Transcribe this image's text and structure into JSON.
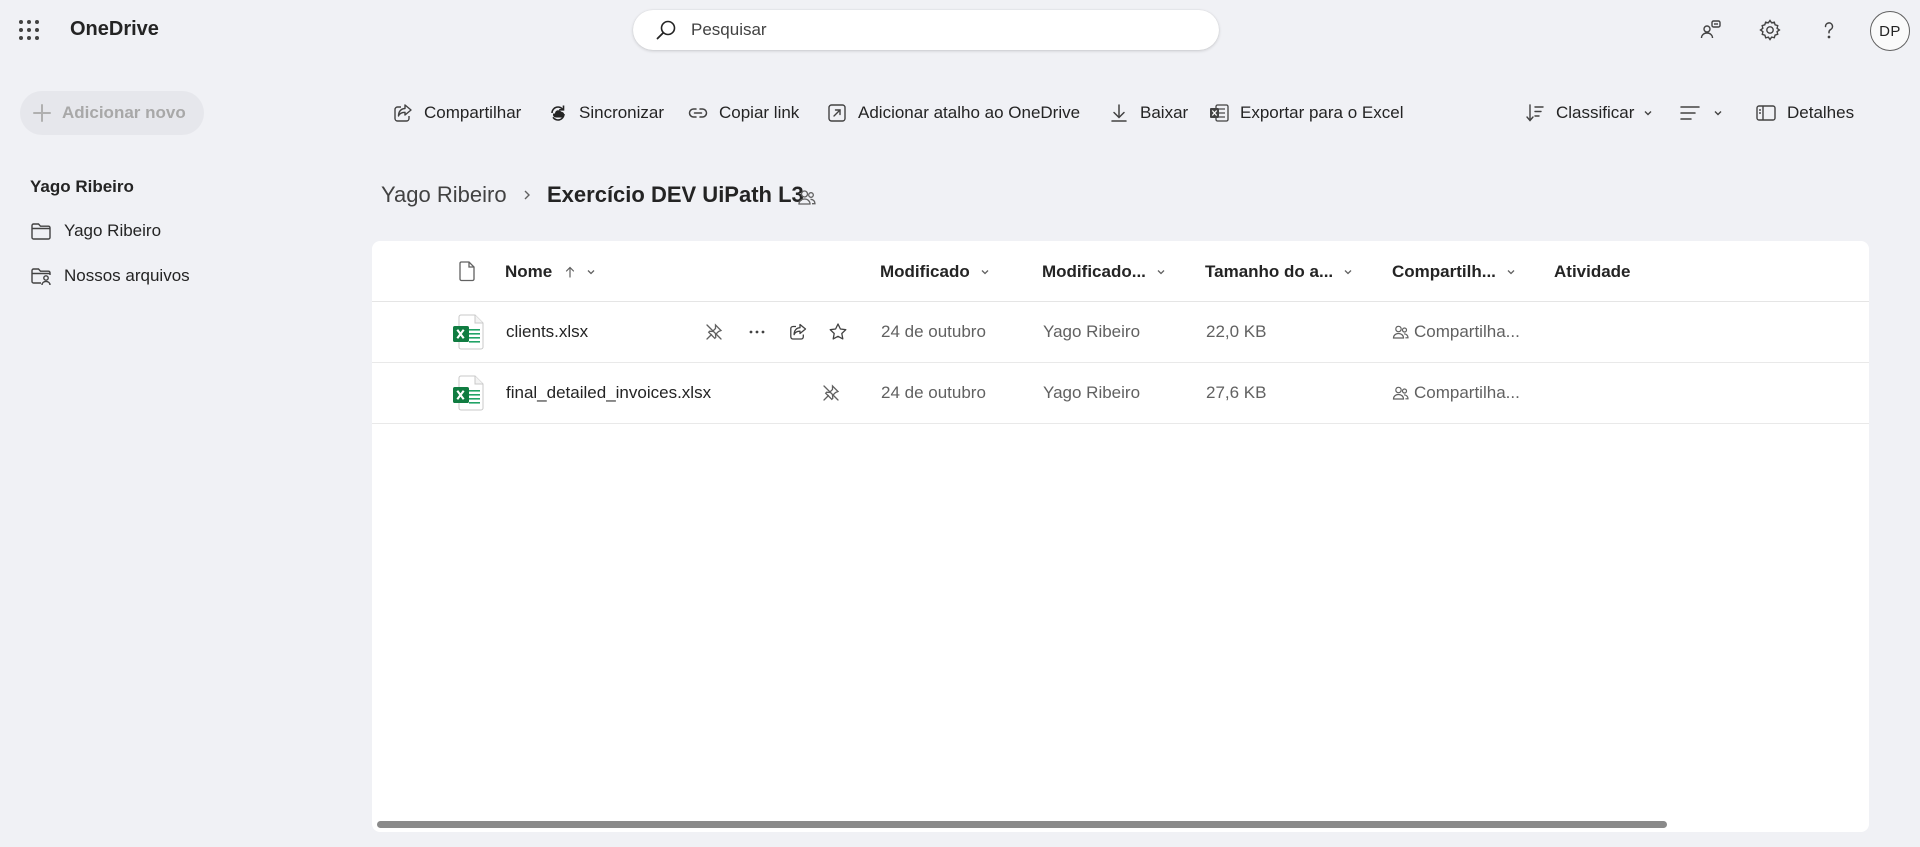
{
  "header": {
    "app_name": "OneDrive",
    "search_placeholder": "Pesquisar",
    "avatar_initials": "DP",
    "icons": [
      "waffle-icon",
      "search-icon",
      "premium-icon",
      "gear-icon",
      "help-icon"
    ]
  },
  "sidebar": {
    "add_new_label": "Adicionar novo",
    "section_title": "Yago Ribeiro",
    "items": [
      {
        "label": "Yago Ribeiro",
        "icon": "folder-icon"
      },
      {
        "label": "Nossos arquivos",
        "icon": "shared-folder-icon"
      }
    ]
  },
  "commands": {
    "share": "Compartilhar",
    "sync": "Sincronizar",
    "copy_link": "Copiar link",
    "add_shortcut": "Adicionar atalho ao OneDrive",
    "download": "Baixar",
    "export_excel": "Exportar para o Excel",
    "sort": "Classificar",
    "details": "Detalhes"
  },
  "breadcrumb": {
    "parent": "Yago Ribeiro",
    "current": "Exercício DEV UiPath L3"
  },
  "table": {
    "columns": {
      "name": "Nome",
      "modified": "Modificado",
      "modified_by": "Modificado...",
      "size": "Tamanho do a...",
      "sharing": "Compartilh...",
      "activity": "Atividade"
    },
    "rows": [
      {
        "name": "clients.xlsx",
        "modified": "24 de outubro",
        "modified_by": "Yago Ribeiro",
        "size": "22,0 KB",
        "sharing": "Compartilha..."
      },
      {
        "name": "final_detailed_invoices.xlsx",
        "modified": "24 de outubro",
        "modified_by": "Yago Ribeiro",
        "size": "27,6 KB",
        "sharing": "Compartilha..."
      }
    ]
  },
  "colors": {
    "background": "#f0f1f5",
    "panel": "#ffffff",
    "excel_green": "#107c41",
    "text": "#242424"
  }
}
